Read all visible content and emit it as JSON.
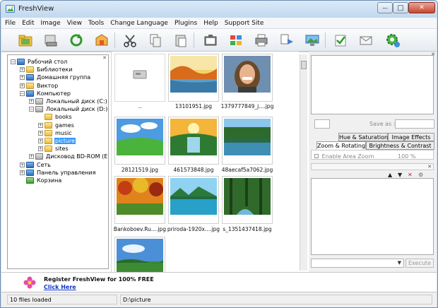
{
  "window": {
    "title": "FreshView",
    "min_glyph": "—",
    "max_glyph": "□",
    "close_glyph": "✕"
  },
  "menu": [
    "File",
    "Edit",
    "Image",
    "View",
    "Tools",
    "Change Language",
    "Plugins",
    "Help",
    "Support Site"
  ],
  "toolbar": {
    "icons": [
      "open-folder-icon",
      "scanner-icon",
      "refresh-icon",
      "explorer-icon",
      "cut-icon",
      "copy-icon",
      "paste-icon",
      "slideshow-icon",
      "thumbnails-icon",
      "print-icon",
      "convert-icon",
      "wallpaper-icon",
      "check-icon",
      "send-mail-icon",
      "plugins-gear-icon"
    ]
  },
  "tree": [
    {
      "label": "Рабочий стол",
      "level": 0,
      "exp": "−",
      "icon": "blue"
    },
    {
      "label": "Библиотеки",
      "level": 1,
      "exp": "+",
      "icon": "folder"
    },
    {
      "label": "Домашняя группа",
      "level": 1,
      "exp": "+",
      "icon": "blue"
    },
    {
      "label": "Виктор",
      "level": 1,
      "exp": "+",
      "icon": "folder"
    },
    {
      "label": "Компьютер",
      "level": 1,
      "exp": "−",
      "icon": "blue"
    },
    {
      "label": "Локальный диск (C:)",
      "level": 2,
      "exp": "+",
      "icon": "drive"
    },
    {
      "label": "Локальный диск (D:)",
      "level": 2,
      "exp": "−",
      "icon": "drive"
    },
    {
      "label": "books",
      "level": 3,
      "exp": "",
      "icon": "folder"
    },
    {
      "label": "games",
      "level": 3,
      "exp": "+",
      "icon": "folder"
    },
    {
      "label": "music",
      "level": 3,
      "exp": "+",
      "icon": "folder"
    },
    {
      "label": "picture",
      "level": 3,
      "exp": "+",
      "icon": "folder",
      "selected": true
    },
    {
      "label": "sites",
      "level": 3,
      "exp": "+",
      "icon": "folder"
    },
    {
      "label": "Дисковод BD-ROM (E:)",
      "level": 2,
      "exp": "+",
      "icon": "drive"
    },
    {
      "label": "Сеть",
      "level": 1,
      "exp": "+",
      "icon": "blue"
    },
    {
      "label": "Панель управления",
      "level": 1,
      "exp": "+",
      "icon": "blue"
    },
    {
      "label": "Корзина",
      "level": 1,
      "exp": "",
      "icon": "green"
    }
  ],
  "thumbnails": [
    {
      "label": "..",
      "kind": "parent"
    },
    {
      "label": "13101951.jpg",
      "kind": "autumn-lake"
    },
    {
      "label": "1379777849_j....jpg",
      "kind": "portrait"
    },
    {
      "label": "28121519.jpg",
      "kind": "green-field"
    },
    {
      "label": "461573848.jpg",
      "kind": "sunset-waterfall"
    },
    {
      "label": "48aecaf5a7062.jpg",
      "kind": "forest-lake"
    },
    {
      "label": "Bankoboev.Ru....jpg",
      "kind": "autumn-forest"
    },
    {
      "label": "priroda-1920x....jpg",
      "kind": "tropical-lake"
    },
    {
      "label": "s_1351437418.jpg",
      "kind": "forest-stream"
    },
    {
      "label": "",
      "kind": "sky-meadow"
    }
  ],
  "right_panel": {
    "save_as_label": "Save as :",
    "tabs_row1": [
      "Hue & Saturation",
      "Image Effects"
    ],
    "tabs_row2": [
      "Zoom & Rotating",
      "Brightness & Contrast"
    ],
    "active_tab": "Zoom & Rotating",
    "enable_area_zoom": "Enable Area Zoom",
    "zoom_value": "100 %",
    "execute_label": "Execute"
  },
  "register": {
    "title": "Register FreshView for 100% FREE",
    "link": "Click Here"
  },
  "status": {
    "files": "10 files loaded",
    "path": "D:\\picture"
  }
}
